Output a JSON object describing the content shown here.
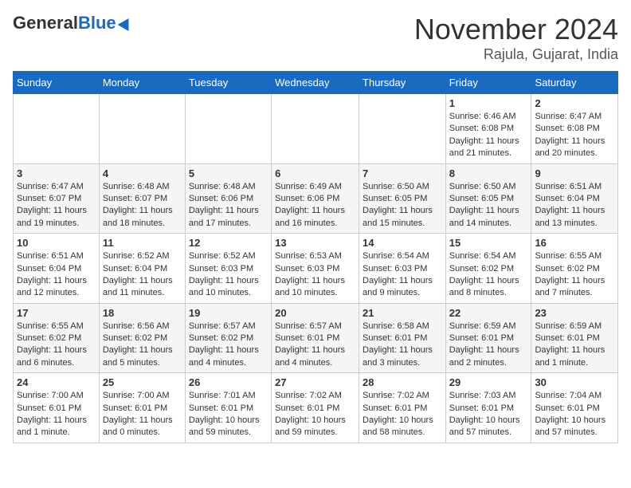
{
  "header": {
    "logo_general": "General",
    "logo_blue": "Blue",
    "title": "November 2024",
    "subtitle": "Rajula, Gujarat, India"
  },
  "weekdays": [
    "Sunday",
    "Monday",
    "Tuesday",
    "Wednesday",
    "Thursday",
    "Friday",
    "Saturday"
  ],
  "weeks": [
    [
      {
        "day": "",
        "info": ""
      },
      {
        "day": "",
        "info": ""
      },
      {
        "day": "",
        "info": ""
      },
      {
        "day": "",
        "info": ""
      },
      {
        "day": "",
        "info": ""
      },
      {
        "day": "1",
        "info": "Sunrise: 6:46 AM\nSunset: 6:08 PM\nDaylight: 11 hours and 21 minutes."
      },
      {
        "day": "2",
        "info": "Sunrise: 6:47 AM\nSunset: 6:08 PM\nDaylight: 11 hours and 20 minutes."
      }
    ],
    [
      {
        "day": "3",
        "info": "Sunrise: 6:47 AM\nSunset: 6:07 PM\nDaylight: 11 hours and 19 minutes."
      },
      {
        "day": "4",
        "info": "Sunrise: 6:48 AM\nSunset: 6:07 PM\nDaylight: 11 hours and 18 minutes."
      },
      {
        "day": "5",
        "info": "Sunrise: 6:48 AM\nSunset: 6:06 PM\nDaylight: 11 hours and 17 minutes."
      },
      {
        "day": "6",
        "info": "Sunrise: 6:49 AM\nSunset: 6:06 PM\nDaylight: 11 hours and 16 minutes."
      },
      {
        "day": "7",
        "info": "Sunrise: 6:50 AM\nSunset: 6:05 PM\nDaylight: 11 hours and 15 minutes."
      },
      {
        "day": "8",
        "info": "Sunrise: 6:50 AM\nSunset: 6:05 PM\nDaylight: 11 hours and 14 minutes."
      },
      {
        "day": "9",
        "info": "Sunrise: 6:51 AM\nSunset: 6:04 PM\nDaylight: 11 hours and 13 minutes."
      }
    ],
    [
      {
        "day": "10",
        "info": "Sunrise: 6:51 AM\nSunset: 6:04 PM\nDaylight: 11 hours and 12 minutes."
      },
      {
        "day": "11",
        "info": "Sunrise: 6:52 AM\nSunset: 6:04 PM\nDaylight: 11 hours and 11 minutes."
      },
      {
        "day": "12",
        "info": "Sunrise: 6:52 AM\nSunset: 6:03 PM\nDaylight: 11 hours and 10 minutes."
      },
      {
        "day": "13",
        "info": "Sunrise: 6:53 AM\nSunset: 6:03 PM\nDaylight: 11 hours and 10 minutes."
      },
      {
        "day": "14",
        "info": "Sunrise: 6:54 AM\nSunset: 6:03 PM\nDaylight: 11 hours and 9 minutes."
      },
      {
        "day": "15",
        "info": "Sunrise: 6:54 AM\nSunset: 6:02 PM\nDaylight: 11 hours and 8 minutes."
      },
      {
        "day": "16",
        "info": "Sunrise: 6:55 AM\nSunset: 6:02 PM\nDaylight: 11 hours and 7 minutes."
      }
    ],
    [
      {
        "day": "17",
        "info": "Sunrise: 6:55 AM\nSunset: 6:02 PM\nDaylight: 11 hours and 6 minutes."
      },
      {
        "day": "18",
        "info": "Sunrise: 6:56 AM\nSunset: 6:02 PM\nDaylight: 11 hours and 5 minutes."
      },
      {
        "day": "19",
        "info": "Sunrise: 6:57 AM\nSunset: 6:02 PM\nDaylight: 11 hours and 4 minutes."
      },
      {
        "day": "20",
        "info": "Sunrise: 6:57 AM\nSunset: 6:01 PM\nDaylight: 11 hours and 4 minutes."
      },
      {
        "day": "21",
        "info": "Sunrise: 6:58 AM\nSunset: 6:01 PM\nDaylight: 11 hours and 3 minutes."
      },
      {
        "day": "22",
        "info": "Sunrise: 6:59 AM\nSunset: 6:01 PM\nDaylight: 11 hours and 2 minutes."
      },
      {
        "day": "23",
        "info": "Sunrise: 6:59 AM\nSunset: 6:01 PM\nDaylight: 11 hours and 1 minute."
      }
    ],
    [
      {
        "day": "24",
        "info": "Sunrise: 7:00 AM\nSunset: 6:01 PM\nDaylight: 11 hours and 1 minute."
      },
      {
        "day": "25",
        "info": "Sunrise: 7:00 AM\nSunset: 6:01 PM\nDaylight: 11 hours and 0 minutes."
      },
      {
        "day": "26",
        "info": "Sunrise: 7:01 AM\nSunset: 6:01 PM\nDaylight: 10 hours and 59 minutes."
      },
      {
        "day": "27",
        "info": "Sunrise: 7:02 AM\nSunset: 6:01 PM\nDaylight: 10 hours and 59 minutes."
      },
      {
        "day": "28",
        "info": "Sunrise: 7:02 AM\nSunset: 6:01 PM\nDaylight: 10 hours and 58 minutes."
      },
      {
        "day": "29",
        "info": "Sunrise: 7:03 AM\nSunset: 6:01 PM\nDaylight: 10 hours and 57 minutes."
      },
      {
        "day": "30",
        "info": "Sunrise: 7:04 AM\nSunset: 6:01 PM\nDaylight: 10 hours and 57 minutes."
      }
    ]
  ]
}
